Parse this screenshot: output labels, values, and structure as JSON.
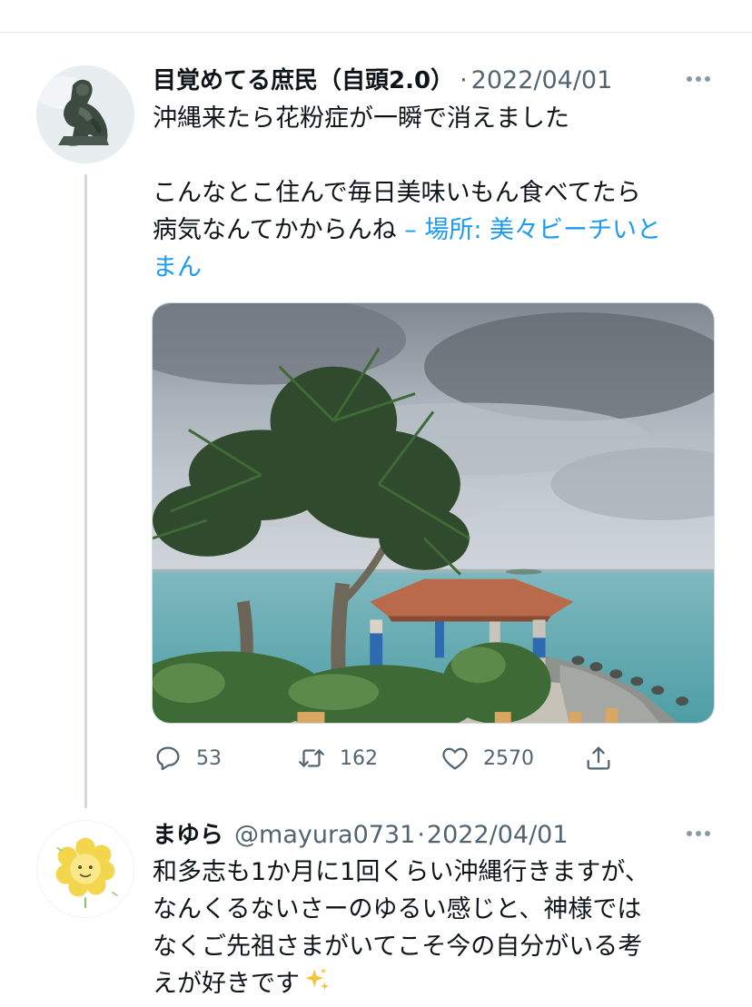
{
  "tweet": {
    "display_name": "目覚めてる庶民（自頭2.0）",
    "separator": "·",
    "date": "2022/04/01",
    "text_lines": [
      "沖縄来たら花粉症が一瞬で消えました",
      "こんなとこ住んで毎日美味いもん食べてたら",
      "病気なんてかからんね"
    ],
    "location_prefix": " – 場所: 美々ビーチいと",
    "location_suffix": "まん",
    "stats": {
      "replies": "53",
      "retweets": "162",
      "likes": "2570"
    },
    "icons": {
      "more": "more-dots-icon",
      "reply": "reply-icon",
      "retweet": "retweet-icon",
      "like": "heart-icon",
      "share": "share-icon"
    }
  },
  "reply": {
    "display_name": "まゆら",
    "handle": "@mayura0731",
    "separator": "·",
    "date": "2022/04/01",
    "text_lines": [
      "和多志も1か月に1回くらい沖縄行きますが、",
      "なんくるないさーのゆるい感じと、神様では",
      "なくご先祖さまがいてこそ今の自分がいる考",
      "えが好きです"
    ],
    "emoji": "sparkles-icon"
  },
  "colors": {
    "text": "#0f1419",
    "secondary": "#536471",
    "link": "#1d9bf0",
    "thread_line": "#cfd9de",
    "divider": "#e6ecf0"
  }
}
